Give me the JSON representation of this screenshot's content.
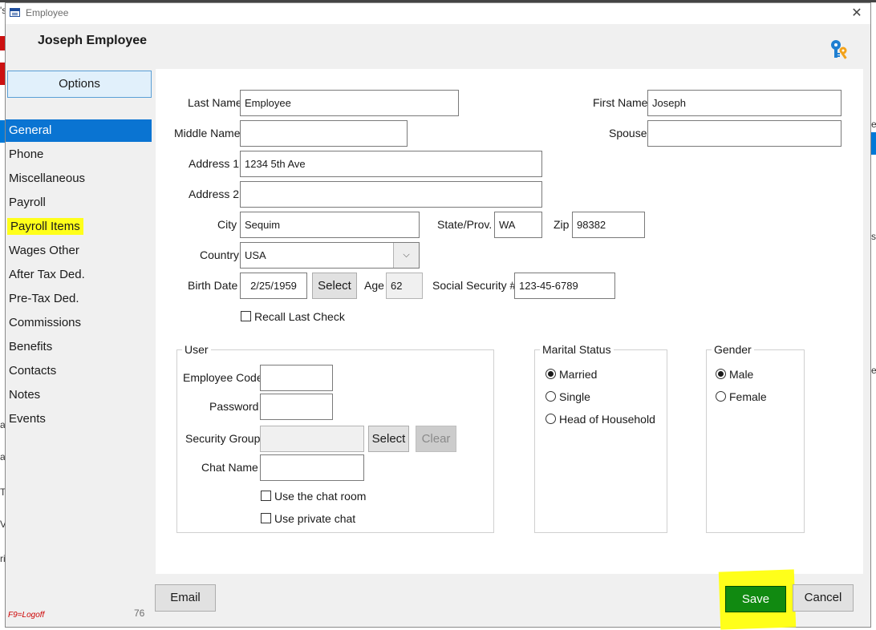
{
  "window": {
    "title": "Employee",
    "close_glyph": "✕"
  },
  "header": {
    "employee_name": "Joseph Employee",
    "icon": "keys-icon"
  },
  "sidebar": {
    "options_label": "Options",
    "items": [
      {
        "label": "General",
        "active": true
      },
      {
        "label": "Phone"
      },
      {
        "label": "Miscellaneous"
      },
      {
        "label": "Payroll"
      },
      {
        "label": "Payroll Items",
        "highlighted": true
      },
      {
        "label": "Wages Other"
      },
      {
        "label": "After Tax Ded."
      },
      {
        "label": "Pre-Tax Ded."
      },
      {
        "label": "Commissions"
      },
      {
        "label": "Benefits"
      },
      {
        "label": "Contacts"
      },
      {
        "label": "Notes"
      },
      {
        "label": "Events"
      }
    ]
  },
  "form": {
    "last_name": {
      "label": "Last Name",
      "value": "Employee"
    },
    "first_name": {
      "label": "First Name",
      "value": "Joseph"
    },
    "middle_name": {
      "label": "Middle Name",
      "value": ""
    },
    "spouse": {
      "label": "Spouse",
      "value": ""
    },
    "address1": {
      "label": "Address 1",
      "value": "1234 5th Ave"
    },
    "address2": {
      "label": "Address 2",
      "value": ""
    },
    "city": {
      "label": "City",
      "value": "Sequim"
    },
    "state": {
      "label": "State/Prov.",
      "value": "WA"
    },
    "zip": {
      "label": "Zip",
      "value": "98382"
    },
    "country": {
      "label": "Country",
      "value": "USA"
    },
    "birth_date": {
      "label": "Birth Date",
      "value": "2/25/1959",
      "select_label": "Select"
    },
    "age": {
      "label": "Age",
      "value": "62"
    },
    "ssn": {
      "label": "Social Security #",
      "value": "123-45-6789"
    },
    "recall_last_check": {
      "label": "Recall Last Check",
      "checked": false
    }
  },
  "user_group": {
    "title": "User",
    "employee_code": {
      "label": "Employee Code",
      "value": ""
    },
    "password": {
      "label": "Password",
      "value": ""
    },
    "security_group": {
      "label": "Security Group",
      "value": "",
      "select_label": "Select",
      "clear_label": "Clear"
    },
    "chat_name": {
      "label": "Chat Name",
      "value": ""
    },
    "use_chat_room": {
      "label": "Use the chat room",
      "checked": false
    },
    "use_private_chat": {
      "label": "Use private chat",
      "checked": false
    }
  },
  "marital_status": {
    "title": "Marital Status",
    "options": [
      {
        "label": "Married",
        "selected": true
      },
      {
        "label": "Single",
        "selected": false
      },
      {
        "label": "Head of Household",
        "selected": false
      }
    ]
  },
  "gender": {
    "title": "Gender",
    "options": [
      {
        "label": "Male",
        "selected": true
      },
      {
        "label": "Female",
        "selected": false
      }
    ]
  },
  "footer": {
    "email_label": "Email",
    "page_number": "76",
    "logoff_hint": "F9=Logoff",
    "save_label": "Save",
    "cancel_label": "Cancel"
  },
  "background_fragments": [
    "'s",
    "e",
    "s",
    "e",
    "a",
    "a",
    "T",
    "V",
    "ri"
  ],
  "colors": {
    "accent": "#0a74d2",
    "highlight": "#ffff1a",
    "save_button": "#118a11",
    "logoff_text": "#cc0000"
  }
}
